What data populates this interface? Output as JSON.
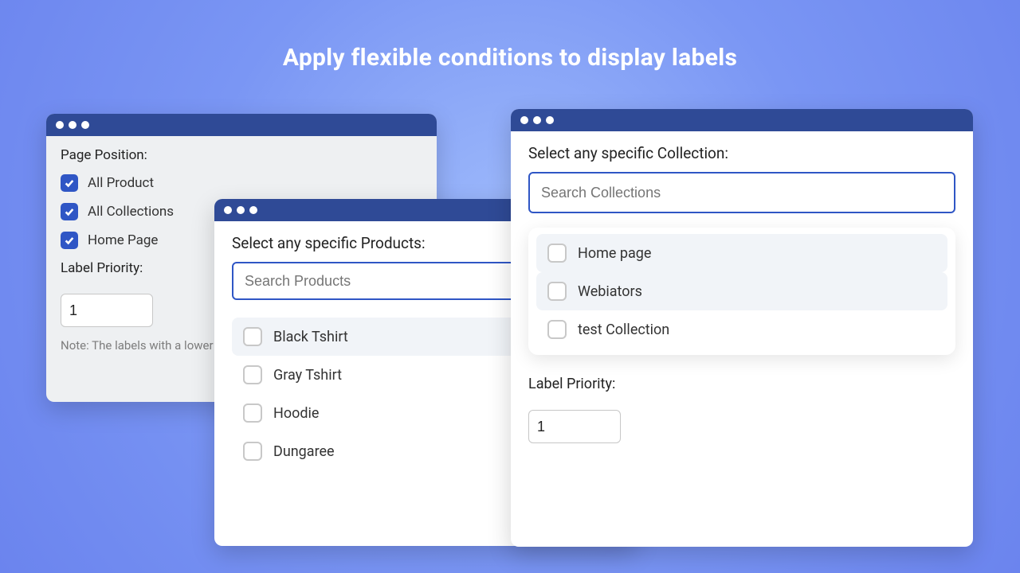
{
  "title": "Apply flexible conditions to display labels",
  "panel1": {
    "heading": "Page Position:",
    "options": [
      "All Product",
      "All Collections",
      "Home Page"
    ],
    "priority_label": "Label Priority:",
    "priority_value": "1",
    "note": "Note: The labels with a lower"
  },
  "panel2": {
    "heading": "Select any specific Products:",
    "placeholder": "Search Products",
    "options": [
      "Black Tshirt",
      "Gray Tshirt",
      "Hoodie",
      "Dungaree"
    ]
  },
  "panel3": {
    "heading": "Select any specific Collection:",
    "placeholder": "Search Collections",
    "options": [
      "Home page",
      "Webiators",
      "test Collection"
    ],
    "priority_label": "Label Priority:",
    "priority_value": "1"
  }
}
